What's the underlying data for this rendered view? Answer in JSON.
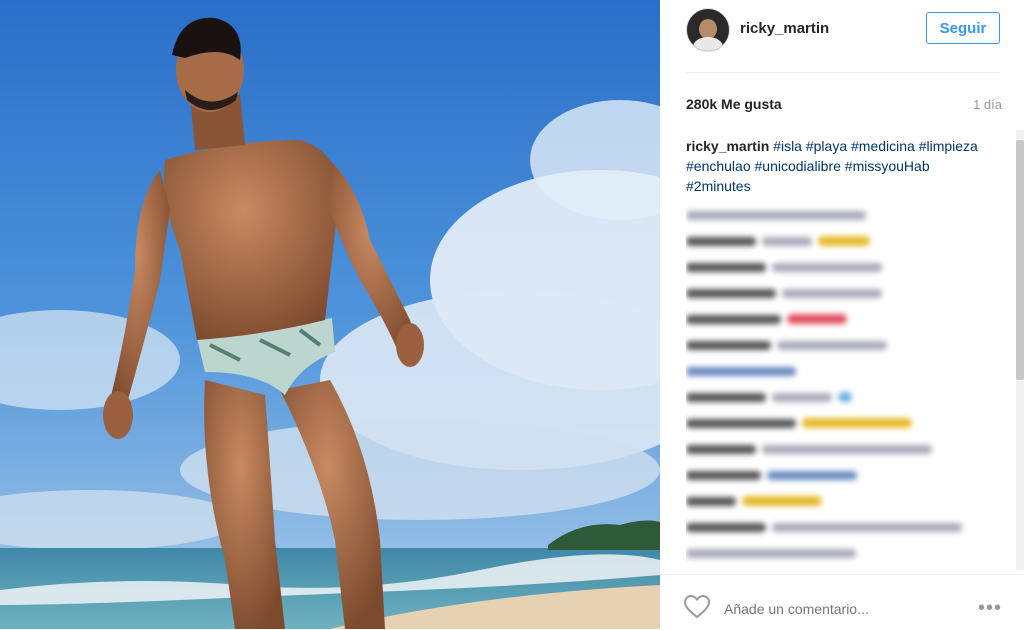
{
  "post": {
    "username": "ricky_martin",
    "follow_label": "Seguir",
    "likes": "280k Me gusta",
    "time": "1 día",
    "caption_user": "ricky_martin",
    "caption_tags": "#isla #playa #medicina #limpieza #enchulao #unicodialibre #missyouHab #2minutes",
    "comment_placeholder": "Añade un comentario...",
    "more_label": "•••"
  },
  "icons": {
    "like": "heart-outline-icon",
    "more": "more-dots-icon",
    "avatar": "user-avatar"
  },
  "colors": {
    "accent": "#3897f0",
    "hashtag": "#003569",
    "text": "#262626",
    "muted": "#999999"
  }
}
